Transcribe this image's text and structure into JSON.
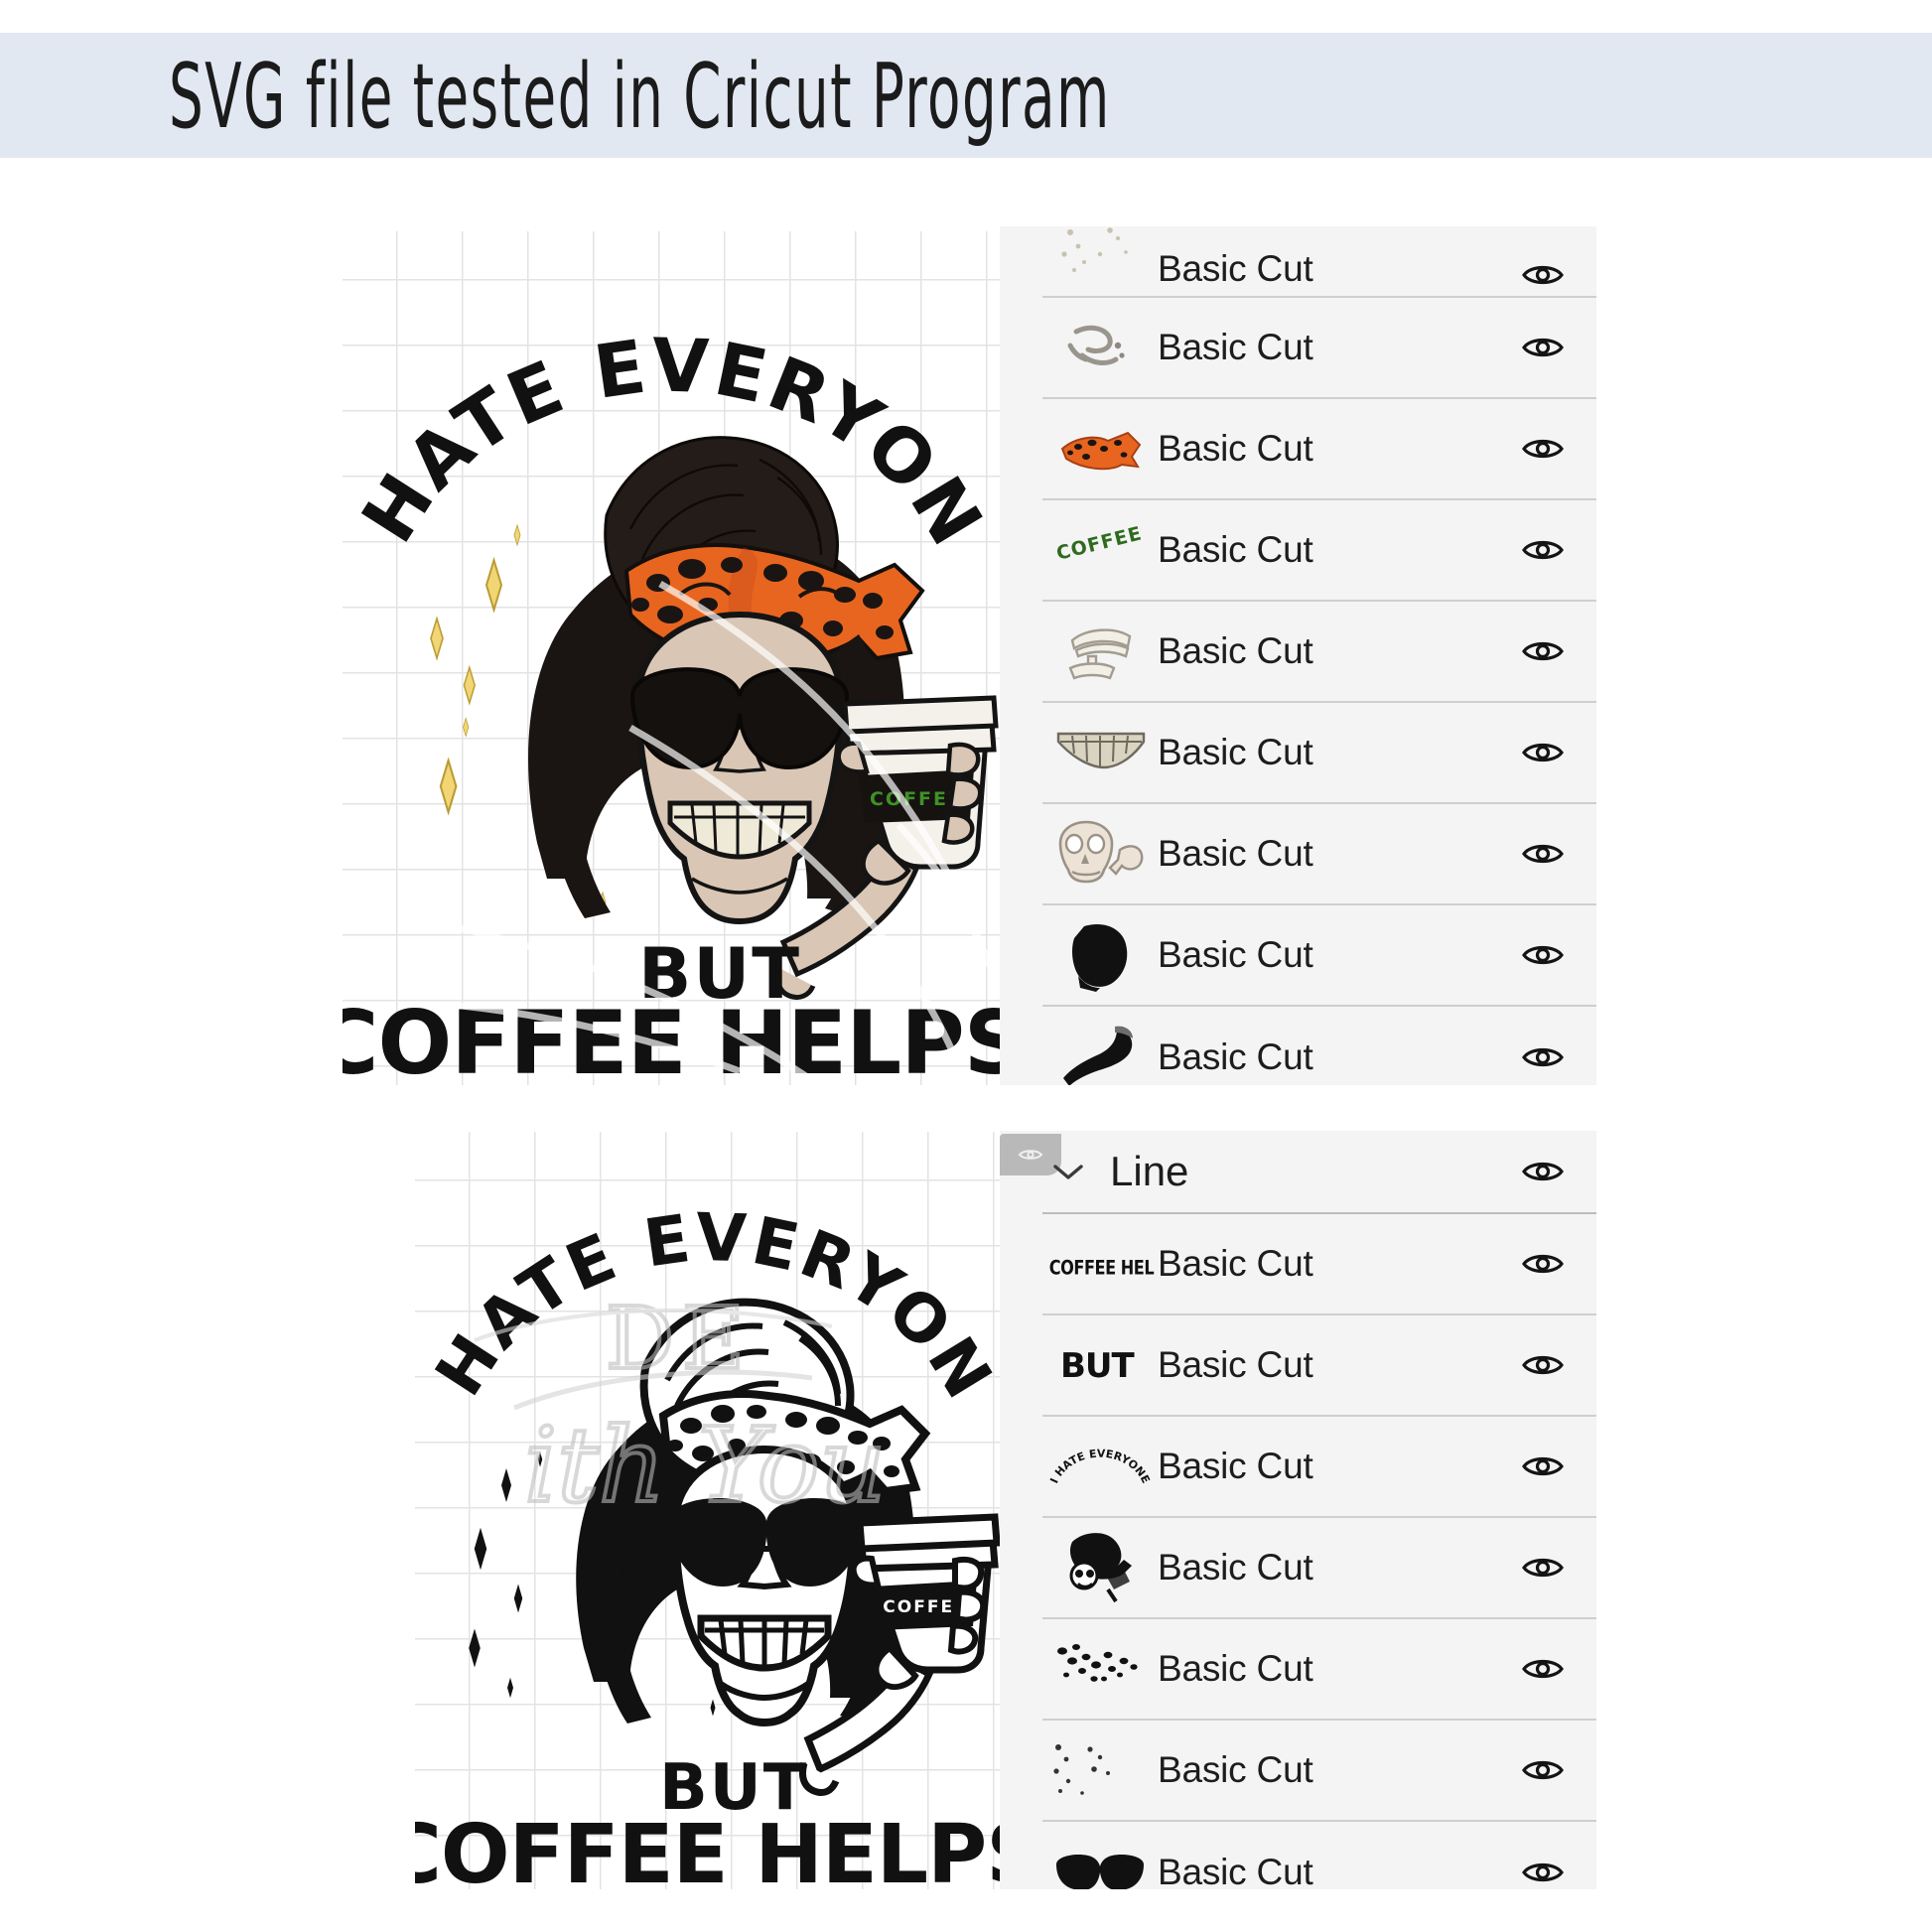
{
  "header": {
    "title": "SVG file tested in Cricut Program",
    "background_color": "#e2e8f2",
    "text_color": "#1b1b1b"
  },
  "design": {
    "top_text_arc": "I HATE EVERYONE",
    "mid_text": "BUT",
    "bottom_text": "COFFEE HELPS",
    "cup_label": "COFFEE",
    "colors": {
      "hair": "#1a1512",
      "bandana_orange": "#e8651f",
      "bandana_spots": "#1a1512",
      "skull": "#d9c6b4",
      "teeth": "#efe9d8",
      "sparkle_yellow": "#f2d574",
      "cup_white": "#f4f1ea",
      "coffee_green": "#2e6b1f",
      "outline": "#141414"
    }
  },
  "panels": {
    "top": {
      "rows": [
        {
          "label": "Basic Cut",
          "thumb": "sparkle-dots-icon",
          "clipped": true
        },
        {
          "label": "Basic Cut",
          "thumb": "gray-squiggle-icon",
          "clipped": false
        },
        {
          "label": "Basic Cut",
          "thumb": "orange-leopard-bandana-icon",
          "clipped": false
        },
        {
          "label": "Basic Cut",
          "thumb": "green-coffee-text-icon",
          "clipped": false
        },
        {
          "label": "Basic Cut",
          "thumb": "cup-lid-outline-icon",
          "clipped": false
        },
        {
          "label": "Basic Cut",
          "thumb": "teeth-icon",
          "clipped": false
        },
        {
          "label": "Basic Cut",
          "thumb": "skull-face-icon",
          "clipped": false
        },
        {
          "label": "Basic Cut",
          "thumb": "black-hair-blob-icon",
          "clipped": false
        },
        {
          "label": "Basic Cut",
          "thumb": "black-arm-icon",
          "clipped": false
        }
      ],
      "eye_icon": "eye-icon"
    },
    "bottom": {
      "group": {
        "label": "Line",
        "chevron": "chevron-down-icon",
        "eye_icon": "eye-icon"
      },
      "rows": [
        {
          "label": "Basic Cut",
          "thumb": "coffee-helps-text-icon"
        },
        {
          "label": "Basic Cut",
          "thumb": "but-text-icon"
        },
        {
          "label": "Basic Cut",
          "thumb": "arc-text-icon"
        },
        {
          "label": "Basic Cut",
          "thumb": "skull-bandana-icon"
        },
        {
          "label": "Basic Cut",
          "thumb": "leopard-dots-icon"
        },
        {
          "label": "Basic Cut",
          "thumb": "sparkle-dots-icon"
        },
        {
          "label": "Basic Cut",
          "thumb": "sunglasses-icon"
        }
      ],
      "eye_icon": "eye-icon"
    }
  },
  "watermark": {
    "line1": "DE",
    "line2": "ith You"
  }
}
